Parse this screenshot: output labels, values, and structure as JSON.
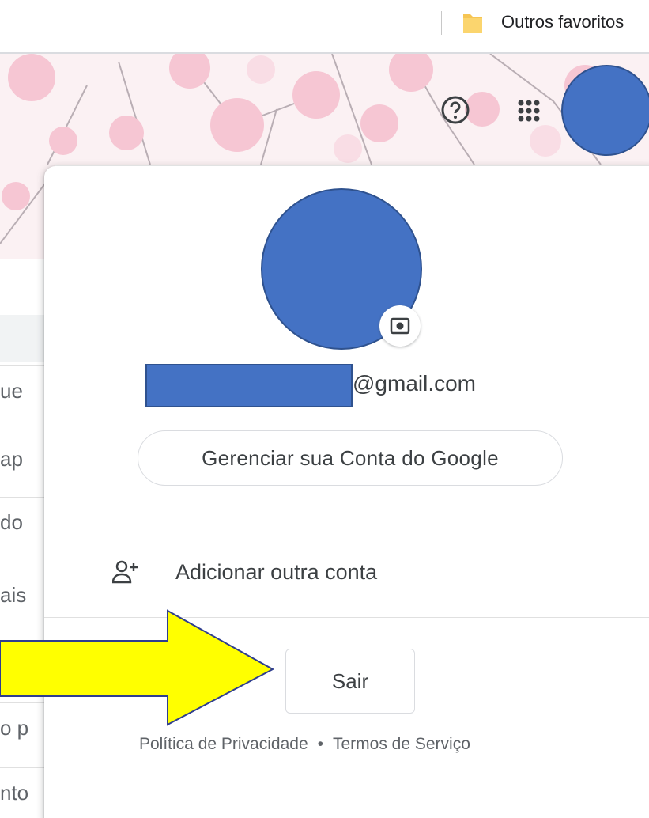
{
  "bookmarks_bar": {
    "folder_label": "Outros favoritos",
    "folder_icon": "folder-icon"
  },
  "header": {
    "help_icon": "help-circle-icon",
    "apps_icon": "apps-grid-icon",
    "account_avatar": "account-avatar-redacted"
  },
  "background_page": {
    "fragments": [
      "ue",
      "ap",
      "do",
      "ais",
      "o p",
      "nto"
    ]
  },
  "account_popup": {
    "avatar": "profile-photo-redacted",
    "camera_icon": "camera-icon",
    "email_suffix": "@gmail.com",
    "manage_account_label": "Gerenciar sua Conta do Google",
    "add_account_label": "Adicionar outra conta",
    "add_account_icon": "person-add-icon",
    "sign_out_label": "Sair",
    "footer": {
      "privacy_label": "Política de Privacidade",
      "separator": "•",
      "terms_label": "Termos de Serviço"
    }
  },
  "annotation": {
    "arrow_color": "#ffff00",
    "arrow_outline": "#2f3e8f",
    "redaction_color": "#4472c4"
  }
}
